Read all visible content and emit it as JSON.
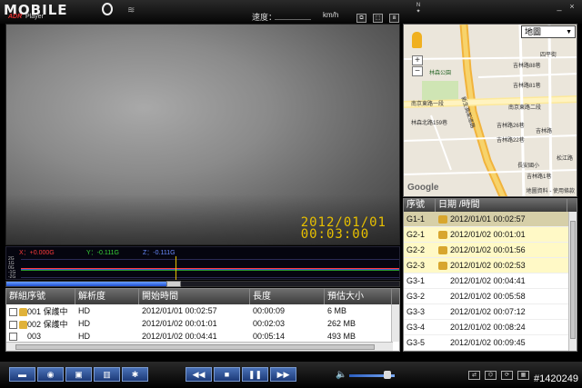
{
  "app": {
    "logo_text": "MOBILE",
    "logo_sub_red": "ADR",
    "logo_sub": "Player",
    "speed_label": "速度：",
    "speed_unit": "km/h",
    "compass": "N",
    "win_controls": [
      "_",
      "×"
    ]
  },
  "video": {
    "osd_date": "2012/01/01",
    "osd_time": "00:03:00"
  },
  "gsensor": {
    "x_label": "X：+0.000G",
    "y_label": "Y：-0.111G",
    "z_label": "Z：-0.111G",
    "axis_ticks": [
      "2G",
      "1G",
      "0G",
      "-1G",
      "-2G"
    ],
    "colors": {
      "x": "#ff3b3b",
      "y": "#39d639",
      "z": "#4b6bff",
      "cursor": "#e8c000"
    },
    "playhead_fraction": 0.41
  },
  "seek": {
    "progress": 0.41
  },
  "file_table": {
    "headers": [
      "群組序號",
      "解析度",
      "開始時間",
      "長度",
      "預估大小"
    ],
    "rows": [
      {
        "group": "001 保護中",
        "locked": true,
        "res": "HD",
        "start": "2012/01/01 00:02:57",
        "length": "00:00:09",
        "size": "6 MB"
      },
      {
        "group": "002 保護中",
        "locked": true,
        "res": "HD",
        "start": "2012/01/02 00:01:01",
        "length": "00:02:03",
        "size": "262 MB"
      },
      {
        "group": "003",
        "locked": false,
        "res": "HD",
        "start": "2012/01/02 00:04:41",
        "length": "00:05:14",
        "size": "493 MB"
      }
    ]
  },
  "map": {
    "map_type": "地圖",
    "labels": [
      "四平街",
      "吉林路88巷",
      "吉林路81巷",
      "林森公園",
      "南京東路一段",
      "南京東路二段",
      "林森北路159巷",
      "新生高架道路",
      "吉林路26巷",
      "吉林路22巷",
      "吉林路",
      "松江路",
      "長安國小",
      "吉林路1巷"
    ],
    "footer": "地圖資料 - 使用條款",
    "logo": "Google",
    "zoom_in": "+",
    "zoom_out": "−"
  },
  "segments": {
    "headers": [
      "序號",
      "日期 /時間"
    ],
    "rows": [
      {
        "id": "G1-1",
        "locked": true,
        "selected": true,
        "time": "2012/01/01 00:02:57"
      },
      {
        "id": "G2-1",
        "locked": true,
        "selected": false,
        "time": "2012/01/02 00:01:01"
      },
      {
        "id": "G2-2",
        "locked": true,
        "selected": false,
        "time": "2012/01/02 00:01:56"
      },
      {
        "id": "G2-3",
        "locked": true,
        "selected": false,
        "time": "2012/01/02 00:02:53"
      },
      {
        "id": "G3-1",
        "locked": false,
        "selected": false,
        "time": "2012/01/02 00:04:41"
      },
      {
        "id": "G3-2",
        "locked": false,
        "selected": false,
        "time": "2012/01/02 00:05:58"
      },
      {
        "id": "G3-3",
        "locked": false,
        "selected": false,
        "time": "2012/01/02 00:07:12"
      },
      {
        "id": "G3-4",
        "locked": false,
        "selected": false,
        "time": "2012/01/02 00:08:24"
      },
      {
        "id": "G3-5",
        "locked": false,
        "selected": false,
        "time": "2012/01/02 00:09:45"
      }
    ]
  },
  "toolbar": {
    "left_buttons": [
      {
        "name": "open-folder-button",
        "icon": "▬"
      },
      {
        "name": "snapshot-button",
        "icon": "◉"
      },
      {
        "name": "save-button",
        "icon": "▣"
      },
      {
        "name": "delete-button",
        "icon": "▥"
      },
      {
        "name": "settings-button",
        "icon": "✱"
      }
    ],
    "transport_buttons": [
      {
        "name": "rewind-button",
        "icon": "◀◀"
      },
      {
        "name": "stop-button",
        "icon": "■"
      },
      {
        "name": "pause-button",
        "icon": "❚❚"
      },
      {
        "name": "fast-forward-button",
        "icon": "▶▶"
      }
    ],
    "volume": 0.84,
    "volume_icon": "🔈"
  },
  "watermark": "#1420249"
}
